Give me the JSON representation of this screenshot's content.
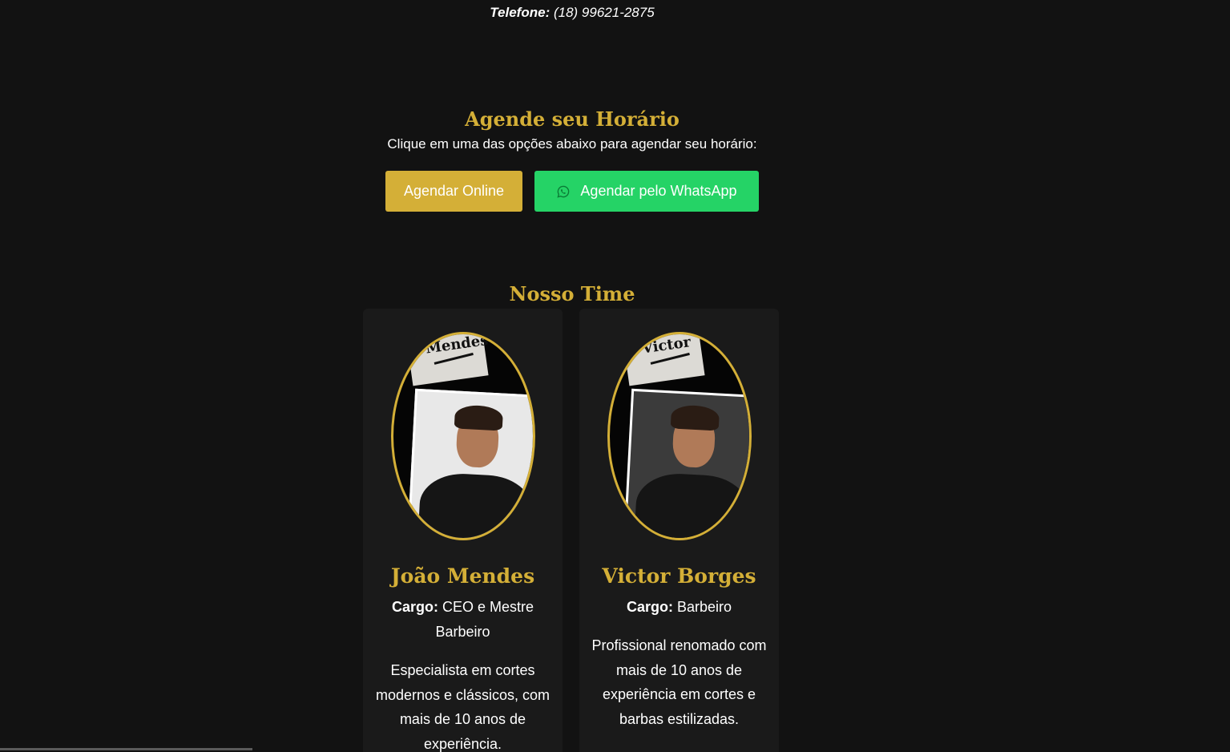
{
  "contact": {
    "phone_label": "Telefone:",
    "phone_value": "(18) 99621-2875"
  },
  "booking": {
    "title": "Agende seu Horário",
    "subtitle": "Clique em uma das opções abaixo para agendar seu horário:",
    "online_label": "Agendar Online",
    "whatsapp_label": "Agendar pelo WhatsApp",
    "whatsapp_icon": "whatsapp-icon"
  },
  "team": {
    "title": "Nosso Time",
    "cargo_label": "Cargo:",
    "members": [
      {
        "name": "João Mendes",
        "cargo": "CEO e Mestre Barbeiro",
        "paper_text": "Mendes",
        "description": "Especialista em cortes modernos e clássicos, com mais de 10 anos de experiência."
      },
      {
        "name": "Victor Borges",
        "cargo": "Barbeiro",
        "paper_text": "Victor",
        "description": "Profissional renomado com mais de 10 anos de experiência em cortes e barbas estilizadas."
      }
    ]
  },
  "colors": {
    "background": "#121212",
    "card": "#1a1a1a",
    "gold": "#d4af37",
    "whatsapp_green": "#25d366"
  }
}
